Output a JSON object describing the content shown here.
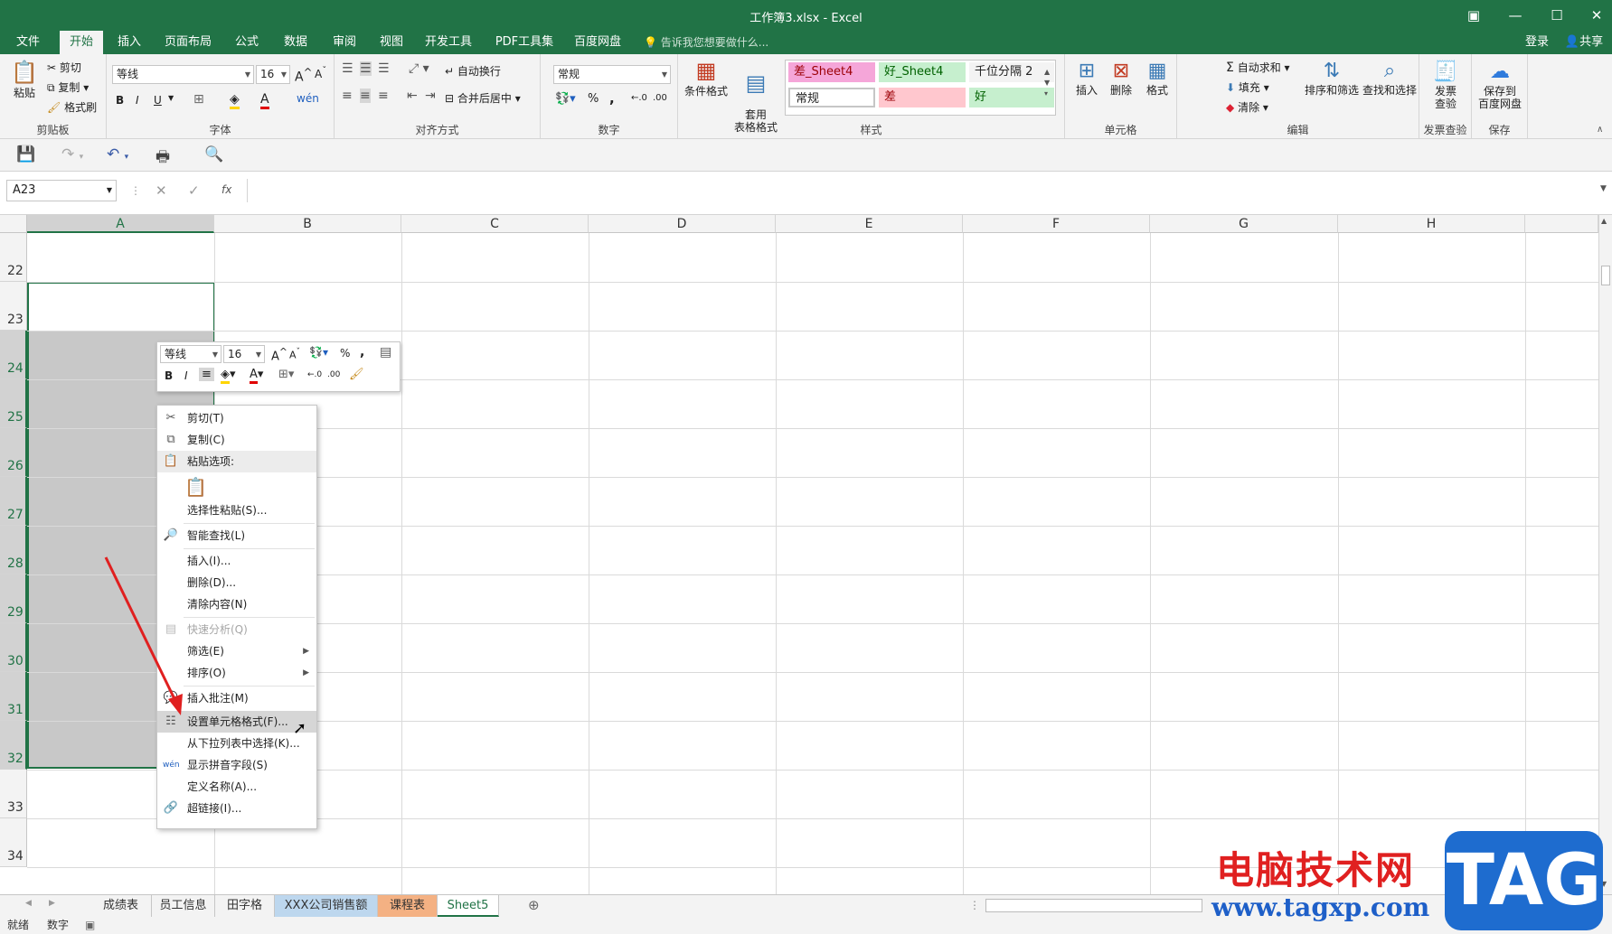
{
  "window": {
    "title": "工作簿3.xlsx - Excel",
    "controls": [
      "restore-ribbon",
      "minimize",
      "maximize",
      "close"
    ]
  },
  "tabs": [
    "文件",
    "开始",
    "插入",
    "页面布局",
    "公式",
    "数据",
    "审阅",
    "视图",
    "开发工具",
    "PDF工具集",
    "百度网盘"
  ],
  "active_tab": "开始",
  "tell_me": "告诉我您想要做什么...",
  "account": {
    "login": "登录",
    "share": "共享"
  },
  "ribbon": {
    "clipboard": {
      "paste": "粘贴",
      "cut": "剪切",
      "copy": "复制",
      "format_painter": "格式刷",
      "label": "剪贴板"
    },
    "font": {
      "name": "等线",
      "size": "16",
      "label": "字体",
      "bold": "B",
      "italic": "I",
      "underline": "U"
    },
    "alignment": {
      "wrap": "自动换行",
      "merge": "合并后居中",
      "label": "对齐方式"
    },
    "number": {
      "format": "常规",
      "percent": "%",
      "comma": ",",
      "label": "数字"
    },
    "styles": {
      "conditional": "条件格式",
      "table": "套用\n表格格式",
      "cells": [
        {
          "text": "差_Sheet4",
          "bg": "#f5a6d9",
          "fg": "#9c0006"
        },
        {
          "text": "好_Sheet4",
          "bg": "#c6efce",
          "fg": "#006100"
        },
        {
          "text": "千位分隔 2",
          "bg": "#f3f3f3",
          "fg": "#222222"
        },
        {
          "text": "常规",
          "bg": "#ffffff",
          "fg": "#222222"
        },
        {
          "text": "差",
          "bg": "#ffc7ce",
          "fg": "#9c0006"
        },
        {
          "text": "好",
          "bg": "#c6efce",
          "fg": "#006100"
        }
      ],
      "label": "样式"
    },
    "cells": {
      "insert": "插入",
      "delete": "删除",
      "format": "格式",
      "label": "单元格"
    },
    "editing": {
      "autosum": "自动求和",
      "fill": "填充",
      "clear": "清除",
      "sort": "排序和筛选",
      "find": "查找和选择",
      "label": "编辑"
    },
    "invoice": {
      "btn": "发票\n查验",
      "label": "发票查验"
    },
    "save": {
      "btn": "保存到\n百度网盘",
      "label": "保存"
    }
  },
  "formula_bar": {
    "name_box": "A23",
    "fx": "fx",
    "value": ""
  },
  "columns": [
    "A",
    "B",
    "C",
    "D",
    "E",
    "F",
    "G",
    "H"
  ],
  "rows": [
    "22",
    "23",
    "24",
    "25",
    "26",
    "27",
    "28",
    "29",
    "30",
    "31",
    "32",
    "33",
    "34"
  ],
  "mini_toolbar": {
    "font": "等线",
    "size": "16"
  },
  "context_menu": {
    "items": [
      {
        "label": "剪切(T)",
        "icon": "scissors-icon"
      },
      {
        "label": "复制(C)",
        "icon": "copy-icon"
      },
      {
        "label": "粘贴选项:",
        "icon": "paste-icon",
        "header": true
      },
      {
        "label": "选择性粘贴(S)...",
        "icon": ""
      },
      {
        "label": "智能查找(L)",
        "icon": "smart-lookup-icon"
      },
      {
        "label": "插入(I)...",
        "icon": ""
      },
      {
        "label": "删除(D)...",
        "icon": ""
      },
      {
        "label": "清除内容(N)",
        "icon": ""
      },
      {
        "label": "快速分析(Q)",
        "icon": "quick-analysis-icon",
        "disabled": true
      },
      {
        "label": "筛选(E)",
        "icon": "",
        "submenu": true
      },
      {
        "label": "排序(O)",
        "icon": "",
        "submenu": true
      },
      {
        "label": "插入批注(M)",
        "icon": "comment-icon"
      },
      {
        "label": "设置单元格格式(F)...",
        "icon": "format-cells-icon",
        "highlighted": true
      },
      {
        "label": "从下拉列表中选择(K)...",
        "icon": ""
      },
      {
        "label": "显示拼音字段(S)",
        "icon": "phonetic-icon"
      },
      {
        "label": "定义名称(A)...",
        "icon": ""
      },
      {
        "label": "超链接(I)...",
        "icon": "link-icon"
      }
    ]
  },
  "sheets": [
    {
      "name": "成绩表",
      "bg": "#f3f3f3"
    },
    {
      "name": "员工信息",
      "bg": "#f3f3f3"
    },
    {
      "name": "田字格",
      "bg": "#f3f3f3"
    },
    {
      "name": "XXX公司销售额",
      "bg": "#bdd7ee"
    },
    {
      "name": "课程表",
      "bg": "#f4b183"
    },
    {
      "name": "Sheet5",
      "bg": "#ffffff",
      "active": true
    }
  ],
  "status": {
    "ready": "就绪",
    "mode": "数字"
  },
  "watermark": {
    "site_name": "电脑技术网",
    "url": "www.tagxp.com",
    "logo": "TAG"
  }
}
